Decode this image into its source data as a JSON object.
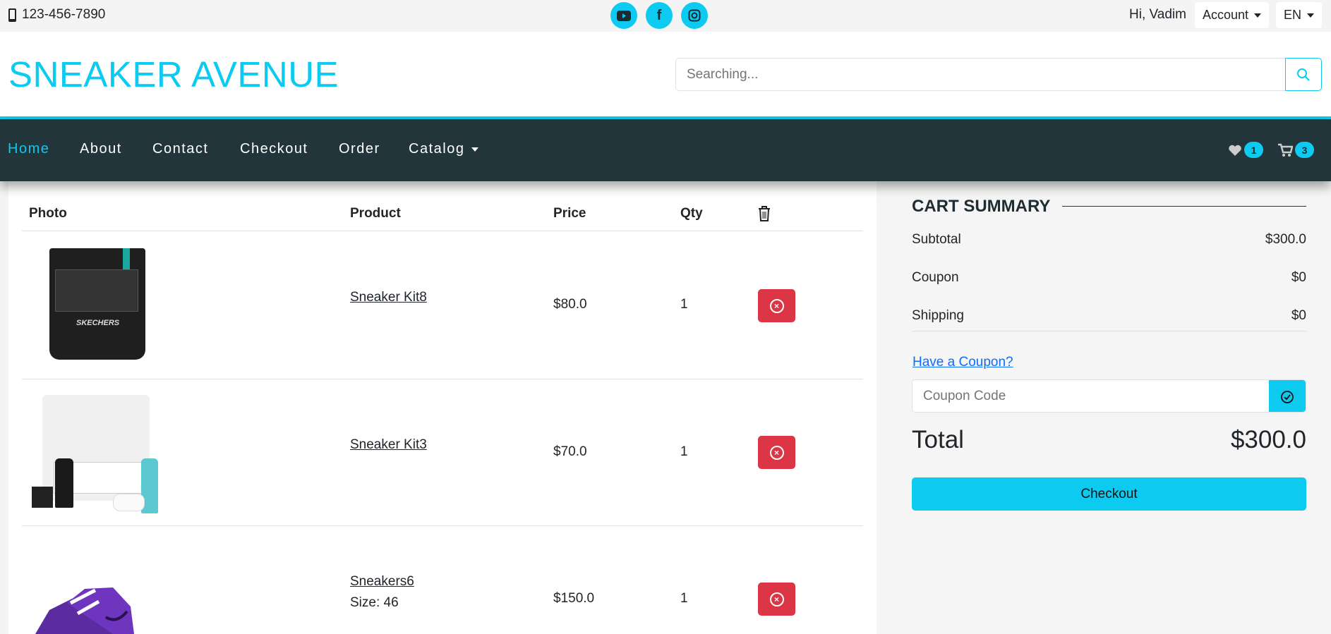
{
  "topbar": {
    "phone": "123-456-7890",
    "greeting": "Hi, Vadim",
    "account": "Account",
    "language": "EN",
    "social": [
      "youtube-icon",
      "facebook-icon",
      "instagram-icon"
    ]
  },
  "header": {
    "logo": "SNEAKER AVENUE",
    "search_placeholder": "Searching..."
  },
  "nav": {
    "items": [
      "Home",
      "About",
      "Contact",
      "Checkout",
      "Order",
      "Catalog"
    ],
    "wishlist_count": "1",
    "cart_count": "3"
  },
  "colors": {
    "accent": "#0dcaf0",
    "nav_bg": "#22353b",
    "danger": "#dc3545"
  },
  "cart": {
    "headers": {
      "photo": "Photo",
      "product": "Product",
      "price": "Price",
      "qty": "Qty"
    },
    "items": [
      {
        "name": "Sneaker Kit8",
        "size": "",
        "price": "$80.0",
        "qty": "1"
      },
      {
        "name": "Sneaker Kit3",
        "size": "",
        "price": "$70.0",
        "qty": "1"
      },
      {
        "name": "Sneakers6",
        "size": "Size: 46",
        "price": "$150.0",
        "qty": "1"
      }
    ]
  },
  "summary": {
    "title": "CART SUMMARY",
    "subtotal_label": "Subtotal",
    "subtotal": "$300.0",
    "coupon_label": "Coupon",
    "coupon": "$0",
    "shipping_label": "Shipping",
    "shipping": "$0",
    "coupon_link": "Have a Coupon?",
    "coupon_placeholder": "Coupon Code",
    "total_label": "Total",
    "total": "$300.0",
    "checkout": "Checkout"
  }
}
